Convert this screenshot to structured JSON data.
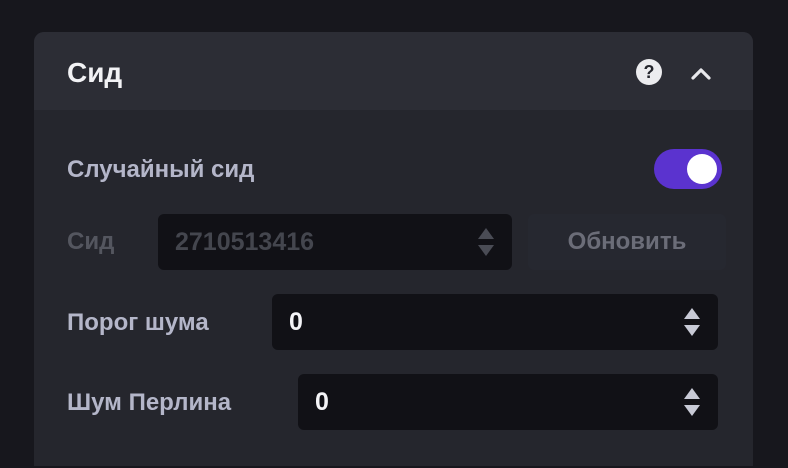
{
  "panel": {
    "title": "Сид",
    "help_glyph": "?",
    "icons": [
      "help-icon",
      "chevron-up-icon"
    ]
  },
  "random_seed": {
    "label": "Случайный сид",
    "enabled": true
  },
  "seed": {
    "label": "Сид",
    "value": "2710513416",
    "disabled": true,
    "refresh_label": "Обновить"
  },
  "noise_threshold": {
    "label": "Порог шума",
    "value": "0"
  },
  "perlin_noise": {
    "label": "Шум Перлина",
    "value": "0"
  },
  "colors": {
    "accent": "#5b33cf",
    "panel": "#25262d",
    "header": "#2c2d35",
    "input": "#111116",
    "label": "#b4b6c9"
  }
}
